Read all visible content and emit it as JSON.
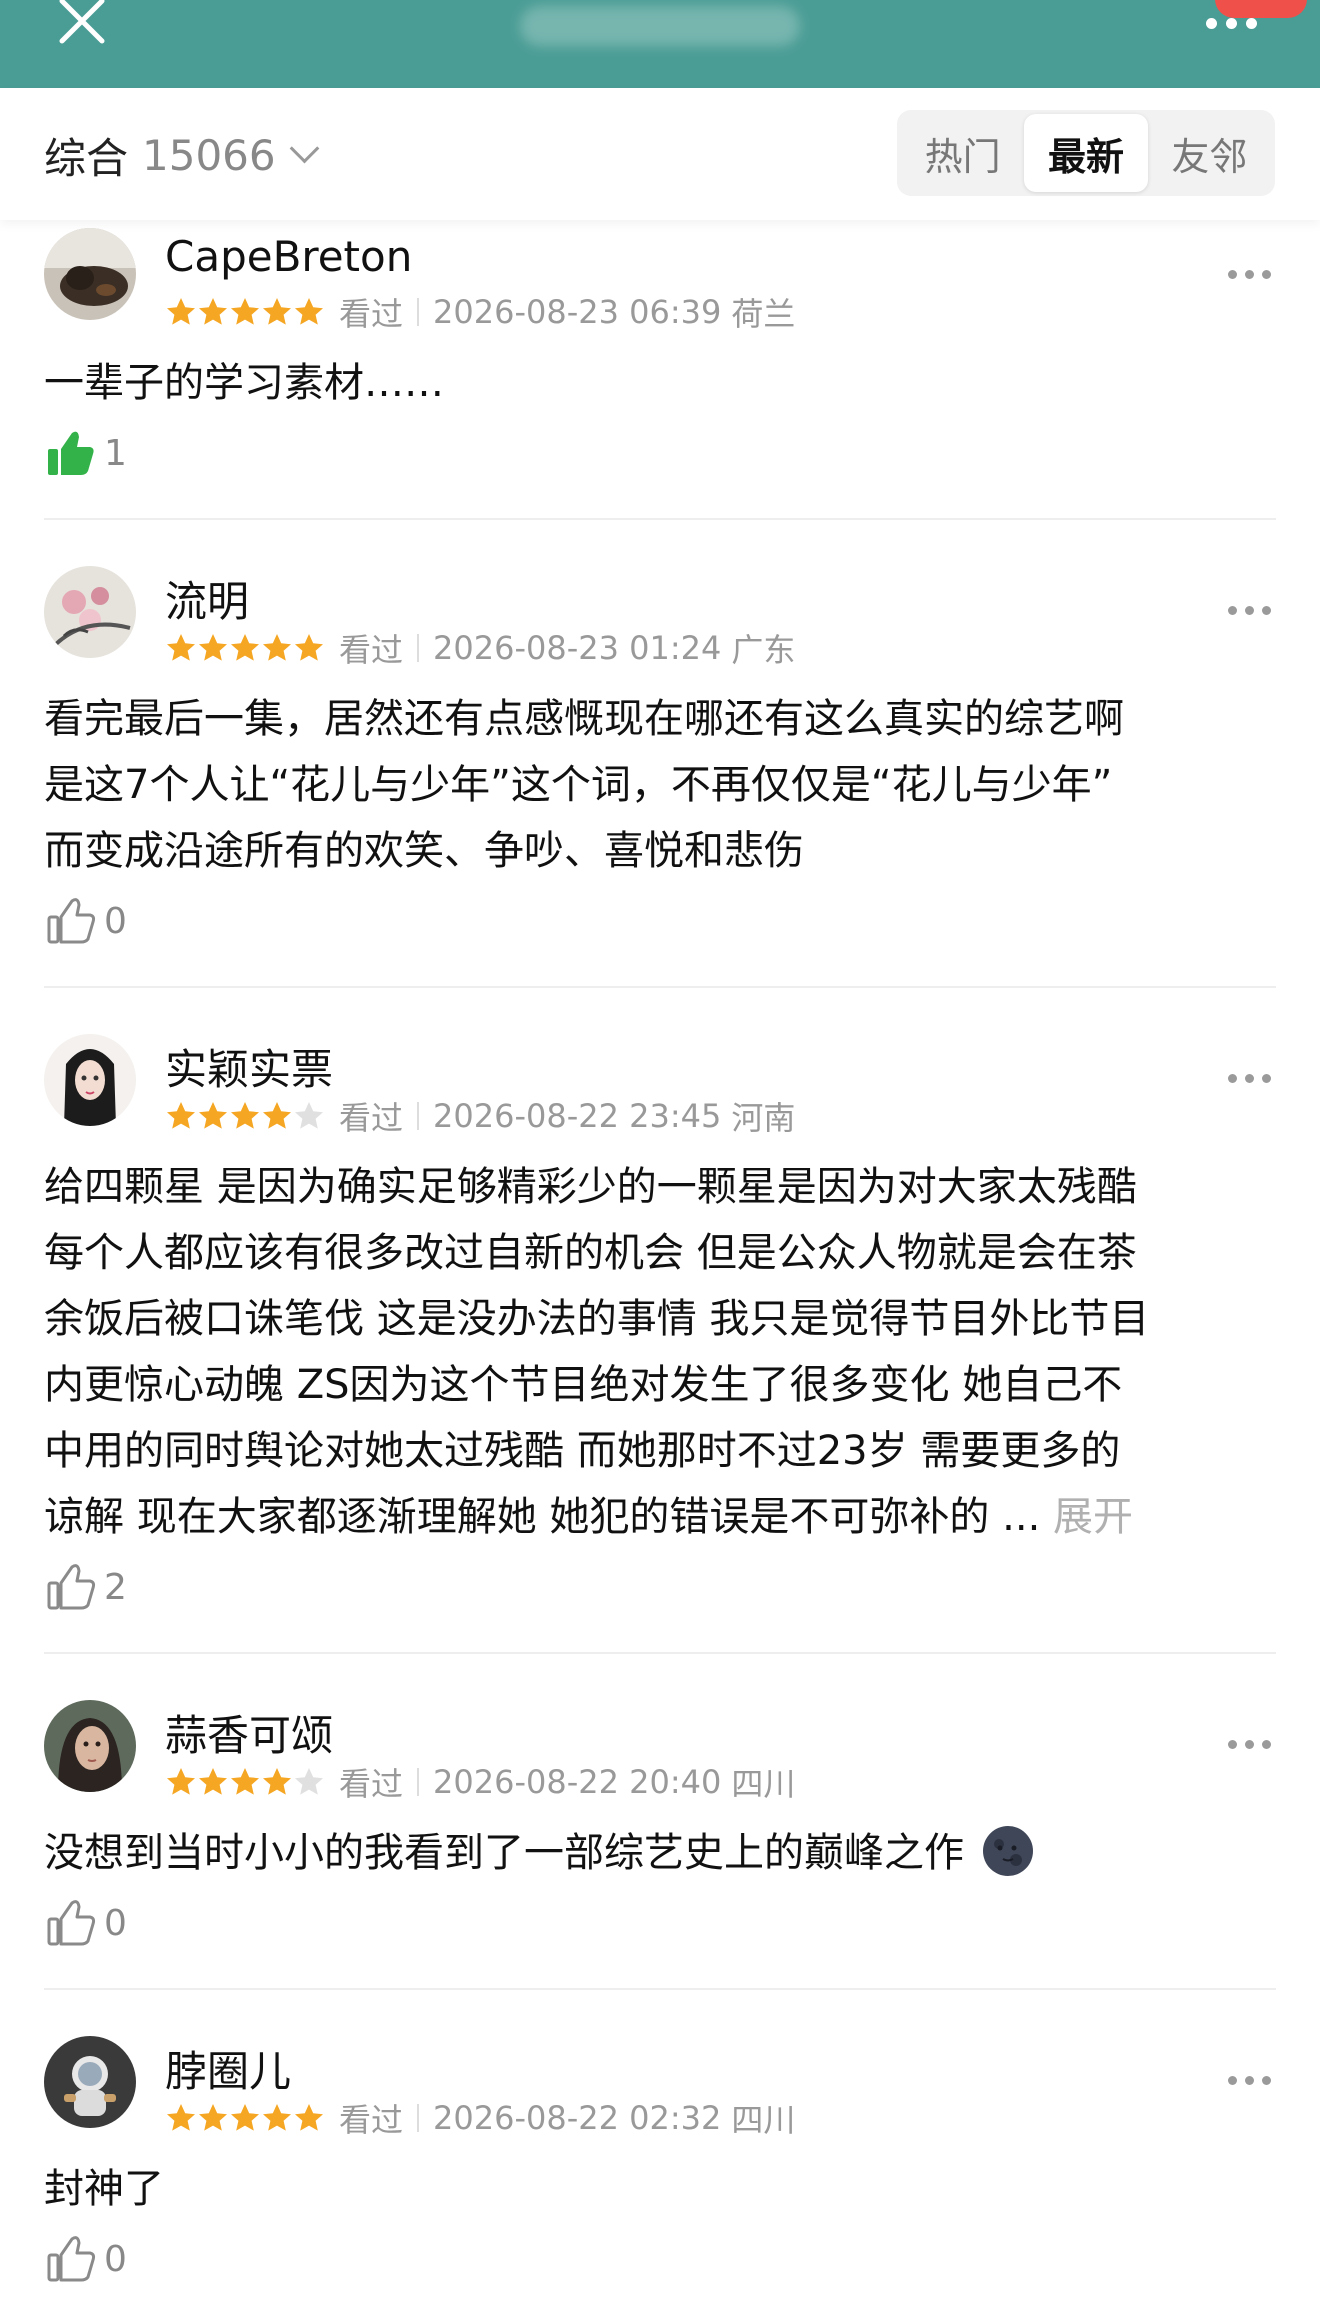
{
  "topbar": {
    "close_icon": "close-icon",
    "more_icon": "more-horizontal-icon",
    "badge_color": "#f0504a",
    "bg_color": "#4a9d95"
  },
  "filter": {
    "label": "综合",
    "count": "15066",
    "tabs": [
      "热门",
      "最新",
      "友邻"
    ],
    "active_tab": "最新"
  },
  "reviews": [
    {
      "username": "CapeBreton",
      "rating": 5,
      "status": "看过",
      "datetime": "2026-08-23 06:39",
      "location": "荷兰",
      "content": "一辈子的学习素材……",
      "likes": "1",
      "liked": true
    },
    {
      "username": "流明",
      "rating": 5,
      "status": "看过",
      "datetime": "2026-08-23 01:24",
      "location": "广东",
      "content_lines": [
        "看完最后一集，居然还有点感慨现在哪还有这么真实的综艺啊",
        "是这7个人让“花儿与少年”这个词，不再仅仅是“花儿与少年”",
        "而变成沿途所有的欢笑、争吵、喜悦和悲伤"
      ],
      "likes": "0",
      "liked": false
    },
    {
      "username": "实颖实票",
      "rating": 4,
      "status": "看过",
      "datetime": "2026-08-22 23:45",
      "location": "河南",
      "content_lines": [
        "给四颗星 是因为确实足够精彩少的一颗星是因为对大家太残酷",
        "每个人都应该有很多改过自新的机会 但是公众人物就是会在茶",
        "余饭后被口诛笔伐 这是没办法的事情 我只是觉得节目外比节目",
        "内更惊心动魄 ZS因为这个节目绝对发生了很多变化 她自己不",
        "中用的同时舆论对她太过残酷 而她那时不过23岁 需要更多的",
        "谅解 现在大家都逐渐理解她 她犯的错误是不可弥补的 ... "
      ],
      "expand_label": "展开",
      "likes": "2",
      "liked": false
    },
    {
      "username": "蒜香可颂",
      "rating": 4,
      "status": "看过",
      "datetime": "2026-08-22 20:40",
      "location": "四川",
      "content": "没想到当时小小的我看到了一部综艺史上的巅峰之作",
      "emoji": "new-moon-face-emoji",
      "likes": "0",
      "liked": false
    },
    {
      "username": "脖圈儿",
      "rating": 5,
      "status": "看过",
      "datetime": "2026-08-22 02:32",
      "location": "四川",
      "content": "封神了",
      "likes": "0",
      "liked": false
    }
  ],
  "colors": {
    "star": "#f5a623",
    "star_empty": "#e0e0e0",
    "like_active": "#34b24a"
  }
}
